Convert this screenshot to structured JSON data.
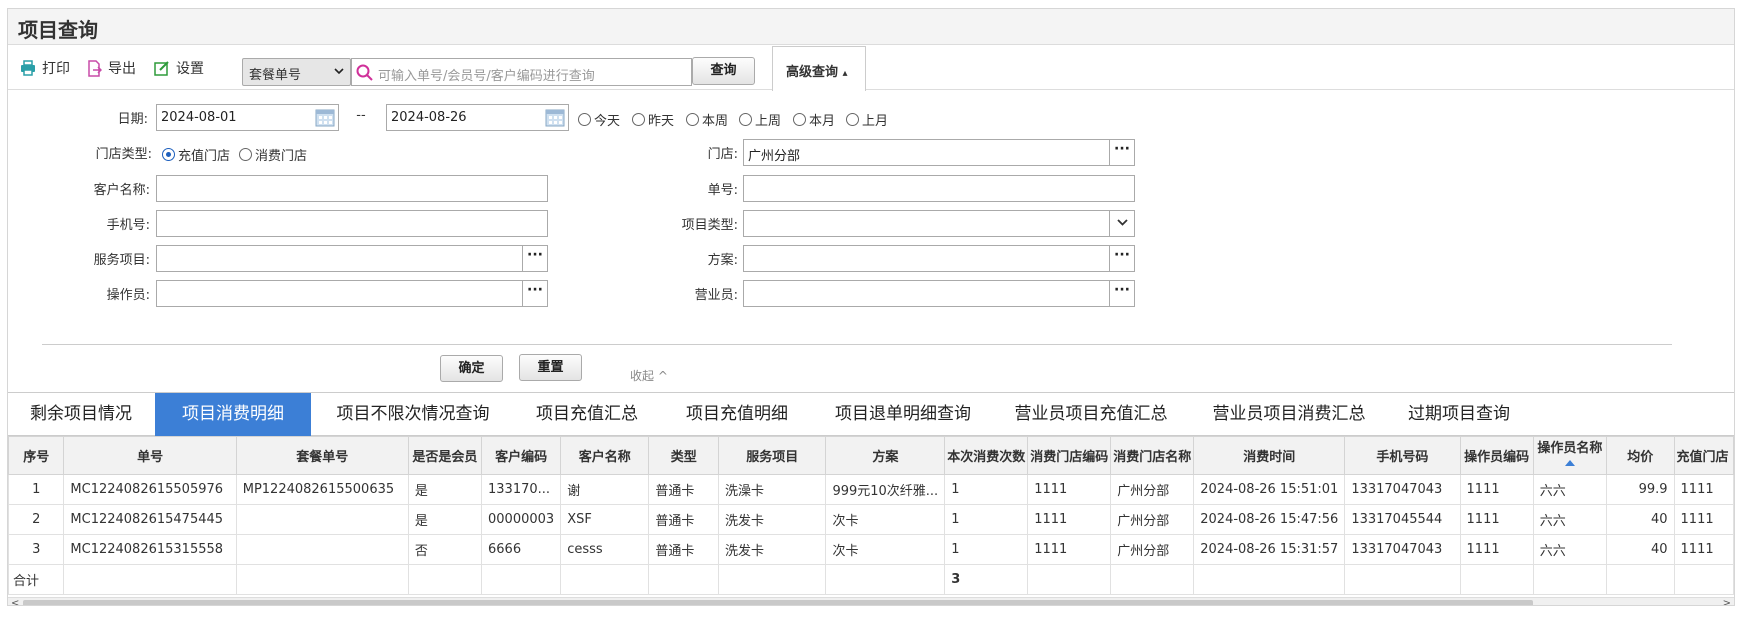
{
  "title": "项目查询",
  "toolbar": {
    "print": "打印",
    "export": "导出",
    "settings": "设置",
    "select_value": "套餐单号",
    "search_placeholder": "可输入单号/会员号/客户编码进行查询",
    "query": "查询",
    "advanced": "高级查询",
    "advanced_arrow": "▴"
  },
  "form": {
    "date_label": "日期:",
    "date_from": "2024-08-01",
    "date_sep": "--",
    "date_to": "2024-08-26",
    "quick_dates": [
      "今天",
      "昨天",
      "本周",
      "上周",
      "本月",
      "上月"
    ],
    "store_type_label": "门店类型:",
    "store_types": [
      "充值门店",
      "消费门店"
    ],
    "store_label": "门店:",
    "store_value": "广州分部",
    "customer_label": "客户名称:",
    "order_label": "单号:",
    "phone_label": "手机号:",
    "item_type_label": "项目类型:",
    "service_label": "服务项目:",
    "plan_label": "方案:",
    "operator_label": "操作员:",
    "salesman_label": "营业员:",
    "confirm": "确定",
    "reset": "重置",
    "collapse": "收起 ^",
    "more": "···"
  },
  "tabs": [
    "剩余项目情况",
    "项目消费明细",
    "项目不限次情况查询",
    "项目充值汇总",
    "项目充值明细",
    "项目退单明细查询",
    "营业员项目充值汇总",
    "营业员项目消费汇总",
    "过期项目查询"
  ],
  "active_tab": 1,
  "table": {
    "headers": [
      "序号",
      "单号",
      "套餐单号",
      "是否是会员",
      "客户编码",
      "客户名称",
      "类型",
      "服务项目",
      "方案",
      "本次消费次数",
      "消费门店编码",
      "消费门店名称",
      "消费时间",
      "手机号码",
      "操作员编码",
      "操作员名称",
      "均价",
      "充值门店"
    ],
    "rows": [
      [
        "1",
        "MC1224082615505976",
        "MP1224082615500635",
        "是",
        "133170...",
        "谢",
        "普通卡",
        "洗澡卡",
        "999元10次纤雅...",
        "1",
        "1111",
        "广州分部",
        "2024-08-26 15:51:01",
        "13317047043",
        "1111",
        "六六",
        "99.9",
        "1111"
      ],
      [
        "2",
        "MC1224082615475445",
        "",
        "是",
        "00000003",
        "XSF",
        "普通卡",
        "洗发卡",
        "次卡",
        "1",
        "1111",
        "广州分部",
        "2024-08-26 15:47:56",
        "13317045544",
        "1111",
        "六六",
        "40",
        "1111"
      ],
      [
        "3",
        "MC1224082615315558",
        "",
        "否",
        "6666",
        "cesss",
        "普通卡",
        "洗发卡",
        "次卡",
        "1",
        "1111",
        "广州分部",
        "2024-08-26 15:31:57",
        "13317047043",
        "1111",
        "六六",
        "40",
        "1111"
      ]
    ],
    "total_label": "合计",
    "total_count": "3"
  }
}
